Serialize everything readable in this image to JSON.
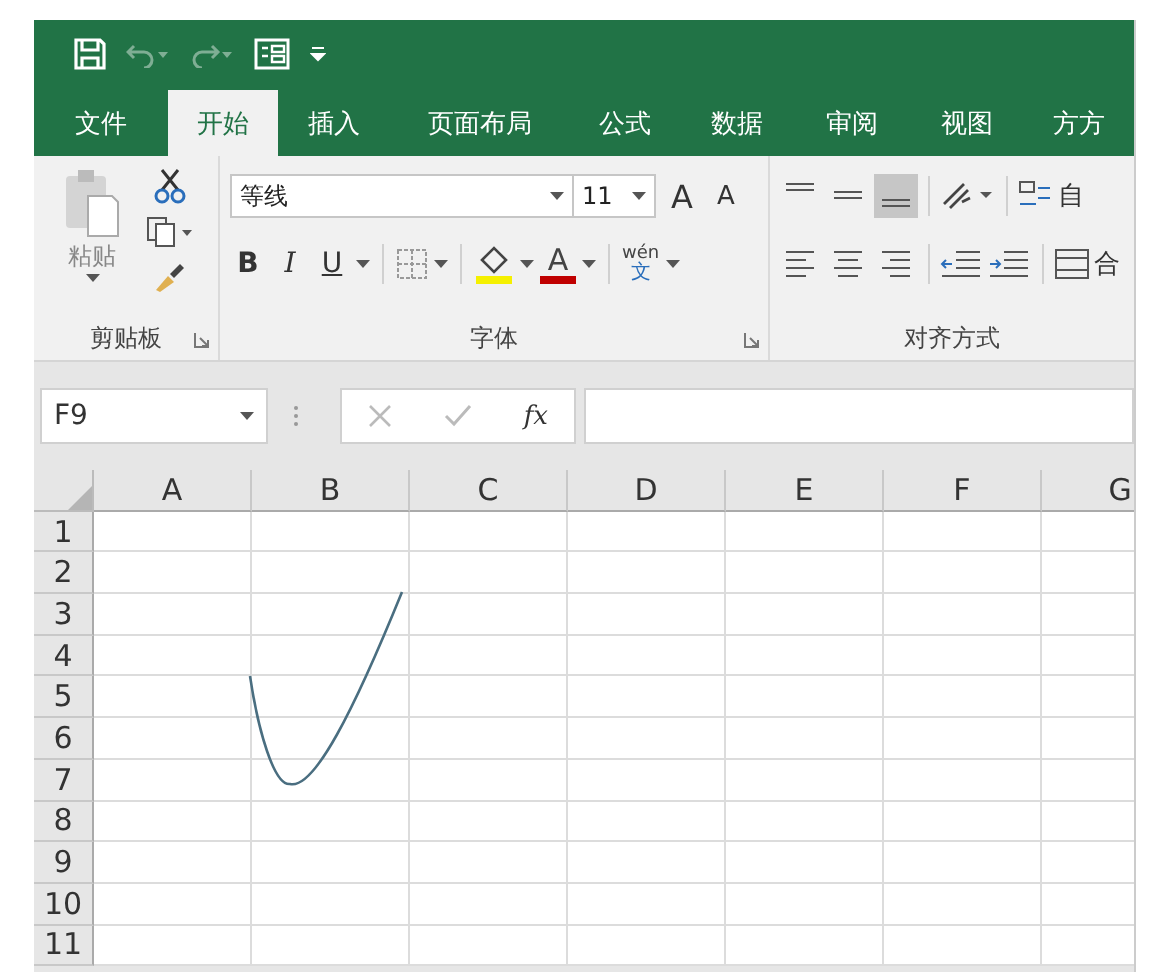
{
  "tabs": [
    {
      "label": "文件",
      "selected": false
    },
    {
      "label": "开始",
      "selected": true
    },
    {
      "label": "插入",
      "selected": false
    },
    {
      "label": "页面布局",
      "selected": false
    },
    {
      "label": "公式",
      "selected": false
    },
    {
      "label": "数据",
      "selected": false
    },
    {
      "label": "审阅",
      "selected": false
    },
    {
      "label": "视图",
      "selected": false
    },
    {
      "label": "方方",
      "selected": false
    }
  ],
  "ribbon": {
    "clipboard": {
      "paste": "粘贴",
      "label": "剪贴板"
    },
    "font": {
      "font_name": "等线",
      "font_size": "11",
      "grow": "A",
      "shrink": "A",
      "bold": "B",
      "italic": "I",
      "underline": "U",
      "font_color": "A",
      "phonetic_top": "wén",
      "phonetic_bottom": "文",
      "label": "字体"
    },
    "alignment": {
      "label": "对齐方式",
      "vertical_align": [
        {
          "selected": false
        },
        {
          "selected": false
        },
        {
          "selected": true
        }
      ],
      "wrap": "自",
      "merge": "合"
    }
  },
  "formula_bar": {
    "name_box": "F9",
    "fx": "fx"
  },
  "columns": [
    "A",
    "B",
    "C",
    "D",
    "E",
    "F",
    "G"
  ],
  "rows": [
    "1",
    "2",
    "3",
    "4",
    "5",
    "6",
    "7",
    "8",
    "9",
    "10",
    "11"
  ]
}
